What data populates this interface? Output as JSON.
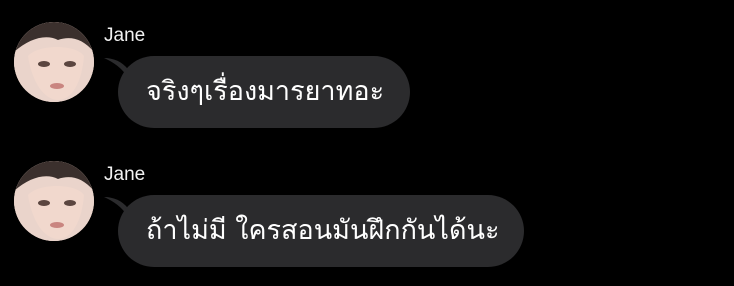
{
  "conversation": {
    "messages": [
      {
        "sender": "Jane",
        "text": "จริงๆเรื่องมารยาทอะ"
      },
      {
        "sender": "Jane",
        "text": "ถ้าไม่มี ใครสอนมันฝึกกันได้นะ"
      }
    ]
  },
  "colors": {
    "background": "#000000",
    "bubble": "#2b2b2d",
    "text": "#ffffff",
    "sender_name": "#f2f2f2"
  },
  "icons": {
    "avatar": "user-avatar-photo"
  }
}
